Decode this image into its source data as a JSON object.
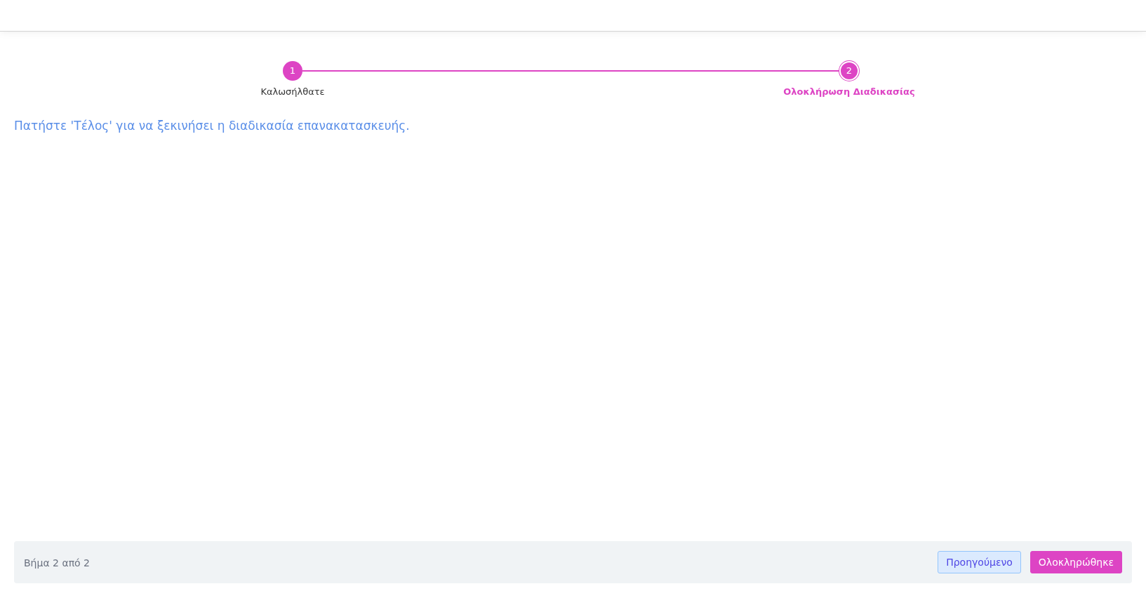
{
  "steps": [
    {
      "number": "1",
      "label": "Καλωσήλθατε",
      "selected": false
    },
    {
      "number": "2",
      "label": "Ολοκλήρωση Διαδικασίας",
      "selected": true
    }
  ],
  "message": "Πατήστε 'Τέλος' για να ξεκινήσει η διαδικασία επανακατασκευής.",
  "footer": {
    "status": "Βήμα 2 από 2",
    "buttons": [
      {
        "label": "Προηγούμενο",
        "kind": "secondary"
      },
      {
        "label": "Ολοκληρώθηκε",
        "kind": "primary"
      }
    ]
  }
}
